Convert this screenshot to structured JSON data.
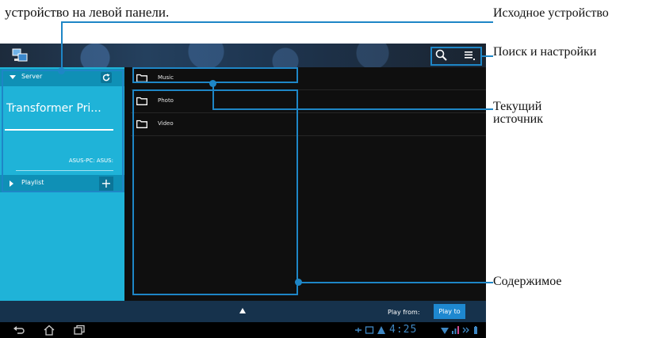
{
  "captions": {
    "top": "устройство на левой панели.",
    "source_device": "Исходное устройство",
    "search_settings": "Поиск и настройки",
    "current_source": "Текущий источник",
    "content": "Содержимое"
  },
  "sidebar": {
    "server_label": "Server",
    "device_name": "Transformer Pri...",
    "device_sub": "ASUS-PC: ASUS:",
    "playlist_label": "Playlist",
    "add_label": "+"
  },
  "files": [
    {
      "label": "Music",
      "icon": "folder-icon"
    },
    {
      "label": "Photo",
      "icon": "folder-icon"
    },
    {
      "label": "Video",
      "icon": "folder-icon"
    }
  ],
  "bottom_bar": {
    "play_from": "Play from:",
    "play_to": "Play to"
  },
  "status": {
    "time": "4:25"
  },
  "colors": {
    "accent": "#1e86c6",
    "panel": "#1fb3d8",
    "panel_row": "#0f90b6",
    "bottom_bar": "#16324c"
  }
}
